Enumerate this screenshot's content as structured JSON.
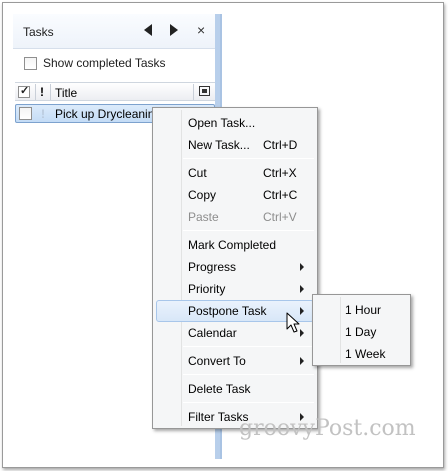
{
  "pane": {
    "title": "Tasks",
    "show_completed_label": "Show completed Tasks",
    "columns": {
      "importance": "!",
      "title": "Title"
    }
  },
  "tasks": [
    {
      "importance": "!",
      "title": "Pick up Drycleaning",
      "selected": true
    }
  ],
  "context_menu": {
    "open_task": "Open Task...",
    "new_task": "New Task...",
    "new_task_key": "Ctrl+D",
    "cut": "Cut",
    "cut_key": "Ctrl+X",
    "copy": "Copy",
    "copy_key": "Ctrl+C",
    "paste": "Paste",
    "paste_key": "Ctrl+V",
    "mark_completed": "Mark Completed",
    "progress": "Progress",
    "priority": "Priority",
    "postpone_task": "Postpone Task",
    "calendar": "Calendar",
    "convert_to": "Convert To",
    "delete_task": "Delete Task",
    "filter_tasks": "Filter Tasks"
  },
  "postpone_submenu": {
    "one_hour": "1 Hour",
    "one_day": "1 Day",
    "one_week": "1 Week"
  },
  "watermark": "groovyPost.com",
  "colors": {
    "selection_fill": "#c4dcf6",
    "selection_border": "#7da2ce",
    "menu_bg": "#f5f6f7",
    "highlight_border": "#a8c6ea",
    "divider": "#b8cfeb"
  },
  "icons": [
    "nav-left-icon",
    "nav-right-icon",
    "close-icon",
    "checkbox-icon",
    "flag-column-icon",
    "submenu-arrow-icon",
    "mouse-pointer-icon"
  ]
}
